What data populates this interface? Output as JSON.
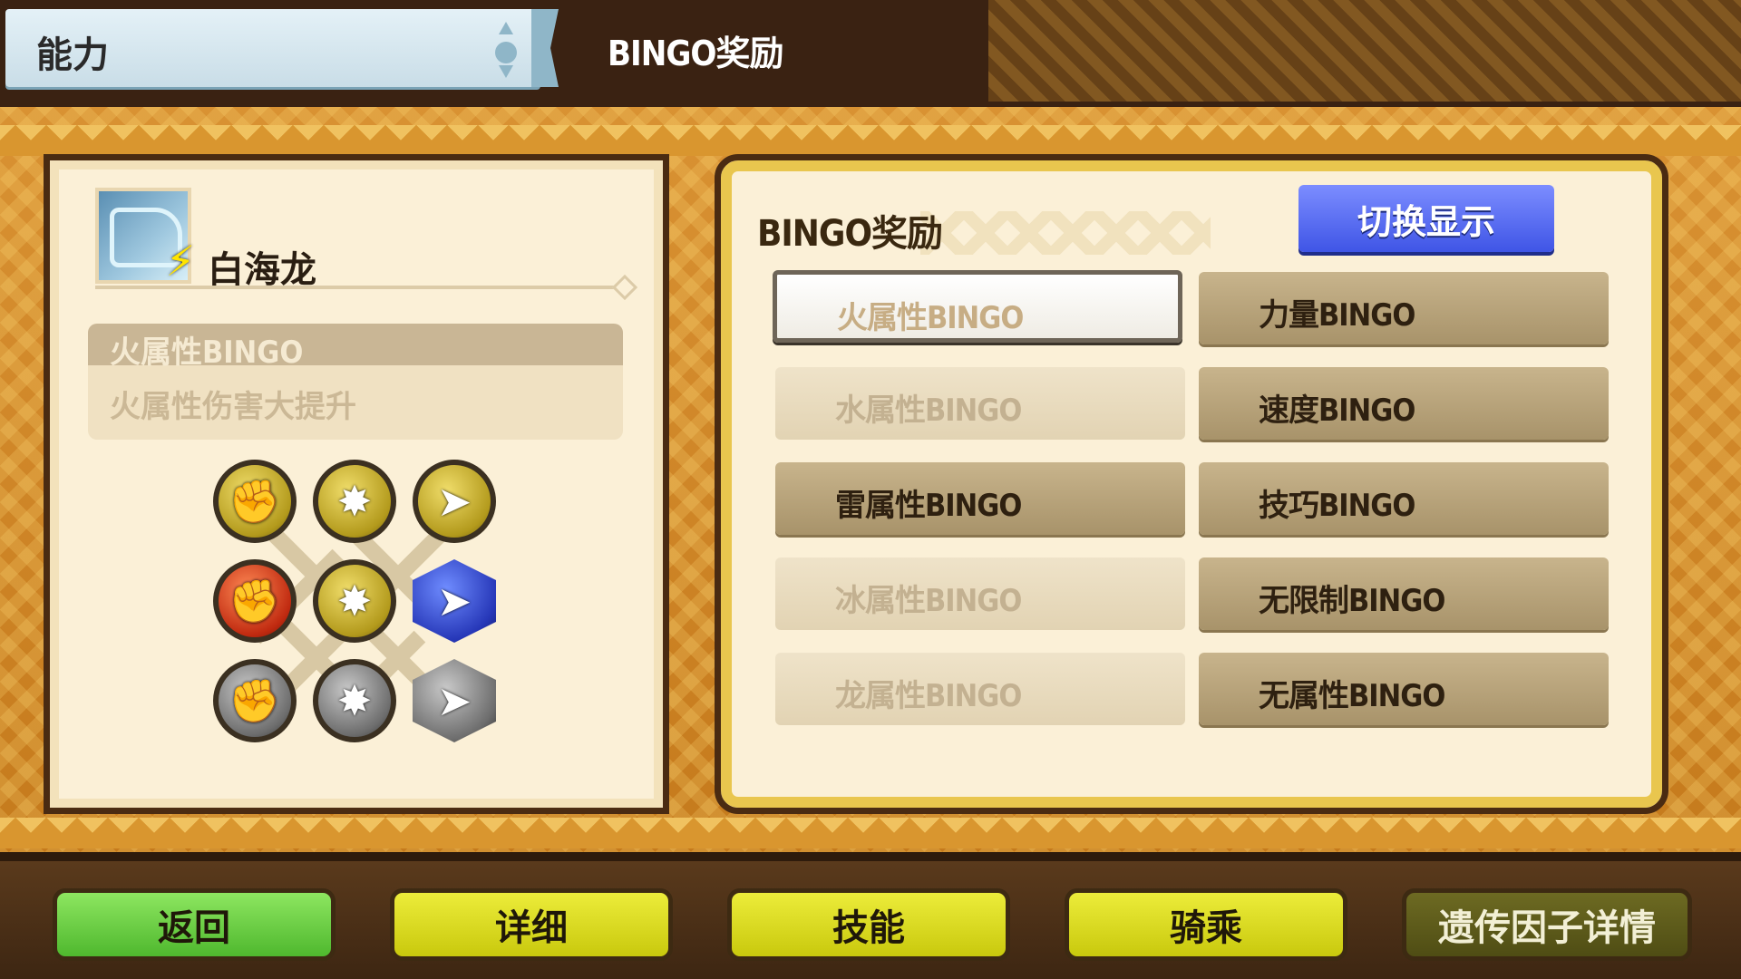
{
  "header": {
    "tab_title": "能力",
    "subtitle": "BINGO奖励"
  },
  "monster": {
    "name": "白海龙",
    "icon": "dragon-portrait-icon",
    "element_icon": "lightning-icon"
  },
  "selected_skill": {
    "name": "火属性BINGO",
    "description": "火属性伤害大提升"
  },
  "gene_grid": [
    [
      "gold-power",
      "gold-technique",
      "gold-speed"
    ],
    [
      "red-power",
      "gold-technique",
      "blue-speed"
    ],
    [
      "grey-power",
      "grey-technique",
      "grey-speed"
    ]
  ],
  "panel": {
    "title": "BINGO奖励",
    "switch_label": "切换显示"
  },
  "bingo_left": [
    {
      "label": "火属性BINGO",
      "state": "selected"
    },
    {
      "label": "水属性BINGO",
      "state": "disabled"
    },
    {
      "label": "雷属性BINGO",
      "state": "active"
    },
    {
      "label": "冰属性BINGO",
      "state": "disabled"
    },
    {
      "label": "龙属性BINGO",
      "state": "disabled"
    }
  ],
  "bingo_right": [
    {
      "label": "力量BINGO",
      "state": "active"
    },
    {
      "label": "速度BINGO",
      "state": "active"
    },
    {
      "label": "技巧BINGO",
      "state": "active"
    },
    {
      "label": "无限制BINGO",
      "state": "active"
    },
    {
      "label": "无属性BINGO",
      "state": "active"
    }
  ],
  "nav": {
    "back": "返回",
    "detail": "详细",
    "skills": "技能",
    "ride": "骑乘",
    "gene_detail": "遗传因子详情"
  },
  "colors": {
    "accent_blue": "#3f55e6",
    "nav_green": "#4fb82e",
    "nav_yellow": "#c9c90d"
  }
}
